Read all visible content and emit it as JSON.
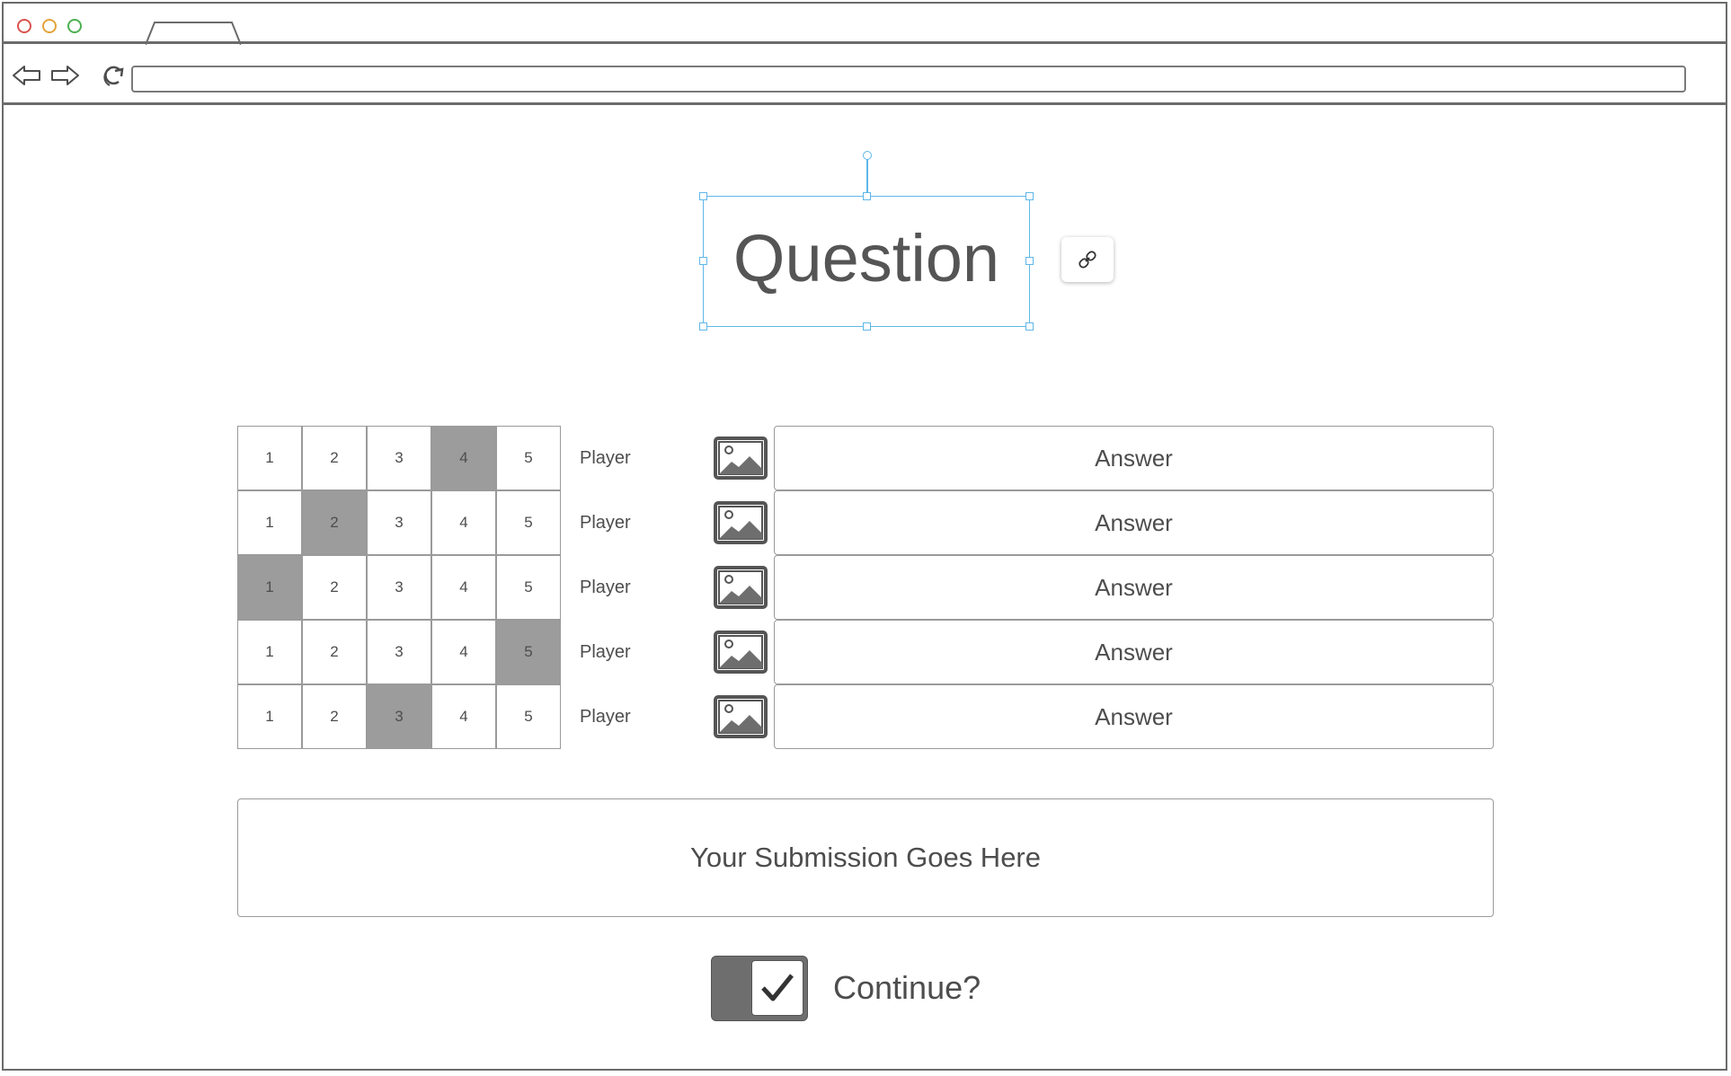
{
  "browser": {
    "url": "",
    "icons": [
      "back-arrow-icon",
      "forward-arrow-icon",
      "reload-icon"
    ]
  },
  "question": {
    "title": "Question",
    "link_icon": "link-icon"
  },
  "players": [
    {
      "cells": [
        "1",
        "2",
        "3",
        "4",
        "5"
      ],
      "selected": 4,
      "label": "Player",
      "icon": "image-icon",
      "answer": "Answer"
    },
    {
      "cells": [
        "1",
        "2",
        "3",
        "4",
        "5"
      ],
      "selected": 2,
      "label": "Player",
      "icon": "image-icon",
      "answer": "Answer"
    },
    {
      "cells": [
        "1",
        "2",
        "3",
        "4",
        "5"
      ],
      "selected": 1,
      "label": "Player",
      "icon": "image-icon",
      "answer": "Answer"
    },
    {
      "cells": [
        "1",
        "2",
        "3",
        "4",
        "5"
      ],
      "selected": 5,
      "label": "Player",
      "icon": "image-icon",
      "answer": "Answer"
    },
    {
      "cells": [
        "1",
        "2",
        "3",
        "4",
        "5"
      ],
      "selected": 3,
      "label": "Player",
      "icon": "image-icon",
      "answer": "Answer"
    }
  ],
  "submission": {
    "text": "Your Submission Goes Here"
  },
  "continue": {
    "label": "Continue?",
    "checked": true,
    "icon": "checkmark-icon"
  },
  "colors": {
    "selection": "#5fb7ea",
    "selected_cell": "#9c9c9c",
    "toggle": "#6e6e6e"
  }
}
